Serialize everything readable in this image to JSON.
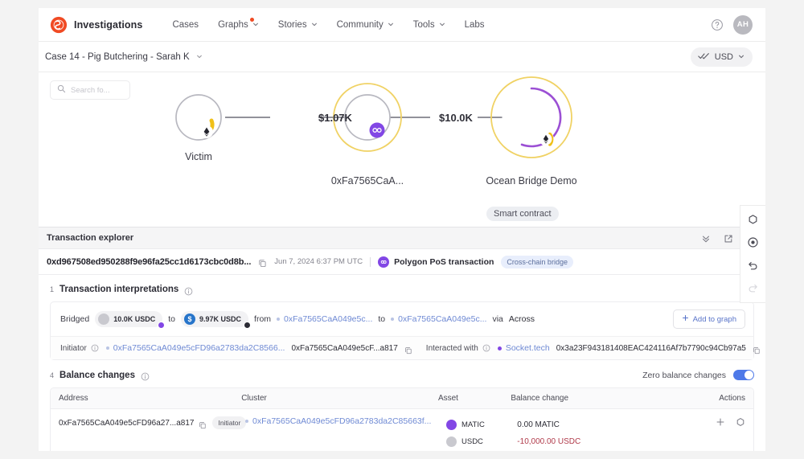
{
  "header": {
    "brand": "Investigations",
    "brand_color": "#f04a23",
    "nav": [
      {
        "label": "Cases",
        "has_caret": false,
        "dot": false
      },
      {
        "label": "Graphs",
        "has_caret": true,
        "dot": true
      },
      {
        "label": "Stories",
        "has_caret": true,
        "dot": false
      },
      {
        "label": "Community",
        "has_caret": true,
        "dot": false
      },
      {
        "label": "Tools",
        "has_caret": true,
        "dot": false
      },
      {
        "label": "Labs",
        "has_caret": false,
        "dot": false
      }
    ],
    "help_icon": "help-circle-icon",
    "avatar_initials": "AH"
  },
  "casebar": {
    "title": "Case 14 - Pig Butchering - Sarah K",
    "currency": "USD",
    "currency_icon": "double-check-icon"
  },
  "canvas": {
    "search_placeholder": "Search fo...",
    "search_value": "",
    "nodes": [
      {
        "label": "Victim",
        "badge": "ethereum",
        "ring": "none",
        "sublabel": ""
      },
      {
        "label": "0xFa7565CaA...",
        "badge": "polygon",
        "ring": "yellow",
        "sublabel": ""
      },
      {
        "label": "Ocean Bridge Demo",
        "badge": "ethereum",
        "ring": "yellow-purple",
        "sublabel": "Smart contract"
      }
    ],
    "edges": [
      {
        "label": "$1.07K"
      },
      {
        "label": "$10.0K"
      }
    ],
    "tools": [
      {
        "name": "shape-tool",
        "disabled": false
      },
      {
        "name": "focus-tool",
        "disabled": false
      },
      {
        "name": "undo-tool",
        "disabled": false
      },
      {
        "name": "redo-tool",
        "disabled": true
      }
    ]
  },
  "tx_panel": {
    "title": "Transaction explorer",
    "actions": [
      "collapse-icon",
      "open-external-icon",
      "close-icon"
    ],
    "hash": "0xd967508ed950288f9e96fa25cc1d6173cbc0d8b...",
    "date": "Jun 7, 2024 6:37 PM UTC",
    "chain": "Polygon PoS transaction",
    "chain_color": "#8247e5",
    "tag": "Cross-chain bridge"
  },
  "interpretations": {
    "count": "1",
    "title": "Transaction interpretations",
    "verb": "Bridged",
    "from_amount": "10.0K USDC",
    "to_word_1": "to",
    "to_amount": "9.97K USDC",
    "from_word": "from",
    "from_address": "0xFa7565CaA049e5c...",
    "to_word_2": "to",
    "to_address": "0xFa7565CaA049e5c...",
    "via_word": "via",
    "via_name": "Across",
    "add_to_graph": "Add to graph",
    "meta": {
      "initiator_label": "Initiator",
      "initiator_link": "0xFa7565CaA049e5cFD96a2783da2C8566...",
      "initiator_addr": "0xFa7565CaA049e5cF...a817",
      "interacted_label": "Interacted with",
      "interacted_name": "Socket.tech",
      "interacted_addr": "0x3a23F943181408EAC424116Af7b7790c94Cb97a5"
    }
  },
  "balance_changes": {
    "count": "4",
    "title": "Balance changes",
    "zero_toggle_label": "Zero balance changes",
    "zero_toggle_on": true,
    "columns": [
      "Address",
      "Cluster",
      "Asset",
      "Balance change",
      "Actions"
    ],
    "rows": [
      {
        "address": "0xFa7565CaA049e5cFD96a27...a817",
        "tag": "Initiator",
        "cluster": "0xFa7565CaA049e5cFD96a2783da2C85663f...",
        "assets": [
          {
            "name": "MATIC",
            "color": "#8247e5",
            "change": "0.00 MATIC",
            "negative": false
          },
          {
            "name": "USDC",
            "color": "#c9c9cf",
            "change": "-10,000.00 USDC",
            "negative": true
          }
        ],
        "actions": [
          "add-icon",
          "circle-icon"
        ]
      }
    ]
  }
}
